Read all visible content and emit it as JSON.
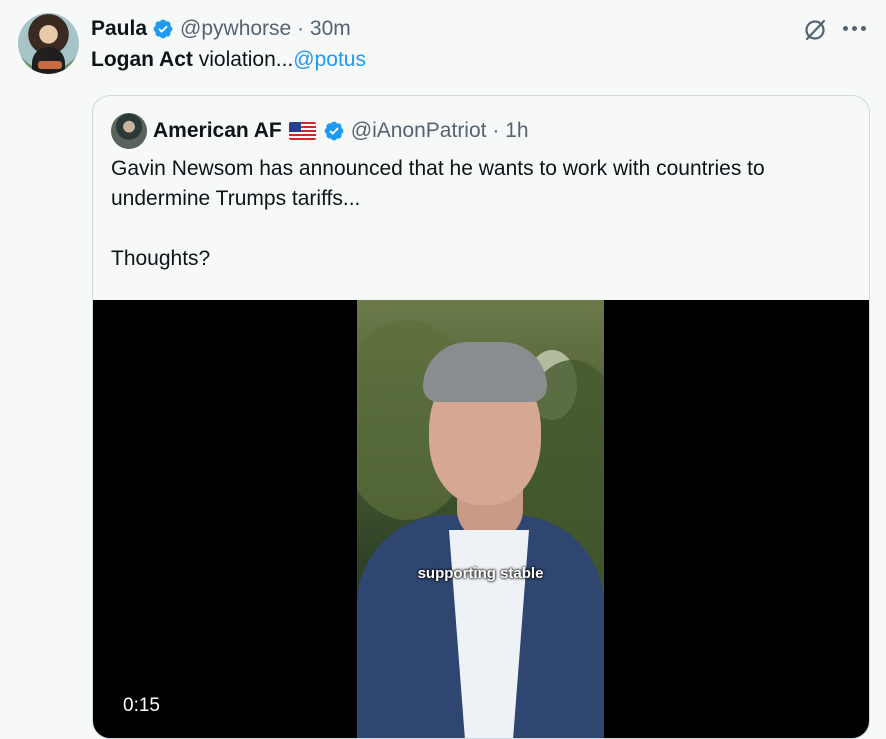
{
  "post": {
    "author_name": "Paula",
    "handle": "@pywhorse",
    "separator": " · ",
    "time": "30m",
    "text_bold": "Logan Act",
    "text_plain": " violation...",
    "mention": "@potus"
  },
  "quote": {
    "author_name": "American AF",
    "handle": "@iAnonPatriot",
    "separator": " · ",
    "time": "1h",
    "text_line1": "Gavin Newsom has announced that he wants to work with countries to undermine Trumps tariffs...",
    "text_line2": "Thoughts?",
    "video": {
      "caption": "supporting stable",
      "duration": "0:15"
    }
  },
  "colors": {
    "accent": "#1d9bf0",
    "muted": "#536471",
    "background": "#f7f9f9"
  },
  "icons": [
    "verified-badge-icon",
    "grok-icon",
    "more-options-icon",
    "us-flag-icon"
  ]
}
